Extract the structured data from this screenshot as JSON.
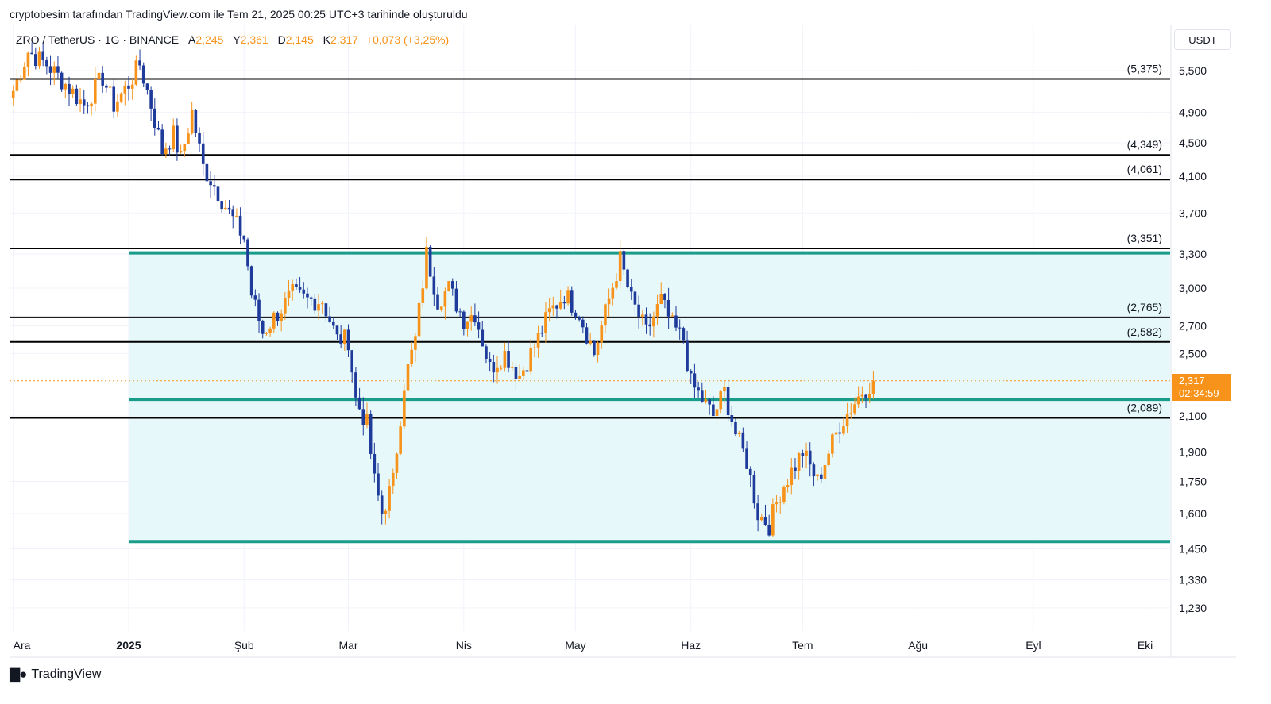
{
  "header": {
    "text": "cryptobesim tarafından TradingView.com ile Tem 21, 2025 00:25 UTC+3 tarihinde oluşturuldu"
  },
  "legend": {
    "symbol": "ZRO / TetherUS · 1G · BINANCE",
    "open_label": "A",
    "open": "2,245",
    "high_label": "Y",
    "high": "2,361",
    "low_label": "D",
    "low": "2,145",
    "close_label": "K",
    "close": "2,317",
    "change": "+0,073 (+3,25%)"
  },
  "currency": "USDT",
  "price_badge": {
    "price": "2,317",
    "countdown": "02:34:59"
  },
  "footer": {
    "brand": "TradingView"
  },
  "colors": {
    "up": "#f7931a",
    "down": "#1e3a9a",
    "zone_fill": "#e6f8fa",
    "zone_line": "#1a9c8a",
    "level_line": "#000000",
    "grid": "#f0f3fa"
  },
  "chart_data": {
    "type": "candlestick",
    "y_axis": {
      "ticks": [
        {
          "label": "5,500",
          "v": 5.5
        },
        {
          "label": "4,900",
          "v": 4.9
        },
        {
          "label": "4,500",
          "v": 4.5
        },
        {
          "label": "4,100",
          "v": 4.1
        },
        {
          "label": "3,700",
          "v": 3.7
        },
        {
          "label": "3,300",
          "v": 3.3
        },
        {
          "label": "3,000",
          "v": 3.0
        },
        {
          "label": "2,700",
          "v": 2.7
        },
        {
          "label": "2,500",
          "v": 2.5
        },
        {
          "label": "2,100",
          "v": 2.1
        },
        {
          "label": "1,900",
          "v": 1.9
        },
        {
          "label": "1,750",
          "v": 1.75
        },
        {
          "label": "1,600",
          "v": 1.6
        },
        {
          "label": "1,450",
          "v": 1.45
        },
        {
          "label": "1,330",
          "v": 1.33
        },
        {
          "label": "1,230",
          "v": 1.23
        }
      ],
      "scale": "log"
    },
    "x_axis": {
      "ticks": [
        {
          "label": "Ara",
          "date": "2024-12-01"
        },
        {
          "label": "2025",
          "date": "2025-01-01",
          "bold": true
        },
        {
          "label": "Şub",
          "date": "2025-02-01"
        },
        {
          "label": "Mar",
          "date": "2025-03-01"
        },
        {
          "label": "Nis",
          "date": "2025-04-01"
        },
        {
          "label": "May",
          "date": "2025-05-01"
        },
        {
          "label": "Haz",
          "date": "2025-06-01"
        },
        {
          "label": "Tem",
          "date": "2025-07-01"
        },
        {
          "label": "Ağu",
          "date": "2025-08-01"
        },
        {
          "label": "Eyl",
          "date": "2025-09-01"
        },
        {
          "label": "Eki",
          "date": "2025-10-01"
        }
      ]
    },
    "levels": [
      {
        "label": "(5,375)",
        "v": 5.375
      },
      {
        "label": "(4,349)",
        "v": 4.349
      },
      {
        "label": "(4,061)",
        "v": 4.061
      },
      {
        "label": "(3,351)",
        "v": 3.351
      },
      {
        "label": "(2,765)",
        "v": 2.765
      },
      {
        "label": "(2,582)",
        "v": 2.582
      },
      {
        "label": "(2,089)",
        "v": 2.089
      }
    ],
    "zone": {
      "start_date": "2025-01-01",
      "top": 3.31,
      "middle": 2.2,
      "bottom": 1.48
    },
    "current_price": 2.317,
    "series_anchors": [
      [
        "2024-12-01",
        5.2
      ],
      [
        "2024-12-05",
        5.8
      ],
      [
        "2024-12-10",
        5.6
      ],
      [
        "2024-12-15",
        5.3
      ],
      [
        "2024-12-20",
        5.0
      ],
      [
        "2024-12-25",
        5.4
      ],
      [
        "2024-12-28",
        5.0
      ],
      [
        "2025-01-01",
        5.3
      ],
      [
        "2025-01-04",
        5.6
      ],
      [
        "2025-01-07",
        5.0
      ],
      [
        "2025-01-10",
        4.4
      ],
      [
        "2025-01-13",
        4.6
      ],
      [
        "2025-01-15",
        4.3
      ],
      [
        "2025-01-18",
        4.9
      ],
      [
        "2025-01-21",
        4.2
      ],
      [
        "2025-01-24",
        4.0
      ],
      [
        "2025-01-28",
        3.7
      ],
      [
        "2025-02-01",
        3.45
      ],
      [
        "2025-02-03",
        2.95
      ],
      [
        "2025-02-06",
        2.65
      ],
      [
        "2025-02-10",
        2.8
      ],
      [
        "2025-02-14",
        2.95
      ],
      [
        "2025-02-18",
        2.9
      ],
      [
        "2025-02-22",
        2.9
      ],
      [
        "2025-02-26",
        2.6
      ],
      [
        "2025-03-01",
        2.6
      ],
      [
        "2025-03-03",
        2.2
      ],
      [
        "2025-03-06",
        2.05
      ],
      [
        "2025-03-08",
        1.75
      ],
      [
        "2025-03-10",
        1.6
      ],
      [
        "2025-03-13",
        1.75
      ],
      [
        "2025-03-16",
        2.3
      ],
      [
        "2025-03-19",
        2.6
      ],
      [
        "2025-03-22",
        3.3
      ],
      [
        "2025-03-25",
        2.9
      ],
      [
        "2025-03-28",
        3.0
      ],
      [
        "2025-04-01",
        2.75
      ],
      [
        "2025-04-04",
        2.8
      ],
      [
        "2025-04-08",
        2.4
      ],
      [
        "2025-04-12",
        2.5
      ],
      [
        "2025-04-16",
        2.35
      ],
      [
        "2025-04-20",
        2.55
      ],
      [
        "2025-04-24",
        2.8
      ],
      [
        "2025-04-28",
        2.95
      ],
      [
        "2025-05-02",
        2.8
      ],
      [
        "2025-05-06",
        2.5
      ],
      [
        "2025-05-09",
        2.8
      ],
      [
        "2025-05-13",
        3.25
      ],
      [
        "2025-05-16",
        2.9
      ],
      [
        "2025-05-20",
        2.65
      ],
      [
        "2025-05-24",
        2.9
      ],
      [
        "2025-05-27",
        2.7
      ],
      [
        "2025-05-30",
        2.6
      ],
      [
        "2025-06-01",
        2.3
      ],
      [
        "2025-06-04",
        2.2
      ],
      [
        "2025-06-07",
        2.1
      ],
      [
        "2025-06-10",
        2.25
      ],
      [
        "2025-06-13",
        2.0
      ],
      [
        "2025-06-16",
        1.85
      ],
      [
        "2025-06-19",
        1.6
      ],
      [
        "2025-06-22",
        1.55
      ],
      [
        "2025-06-25",
        1.7
      ],
      [
        "2025-06-28",
        1.8
      ],
      [
        "2025-07-01",
        1.9
      ],
      [
        "2025-07-05",
        1.75
      ],
      [
        "2025-07-08",
        1.9
      ],
      [
        "2025-07-11",
        2.05
      ],
      [
        "2025-07-14",
        2.15
      ],
      [
        "2025-07-17",
        2.25
      ],
      [
        "2025-07-20",
        2.317
      ]
    ]
  }
}
